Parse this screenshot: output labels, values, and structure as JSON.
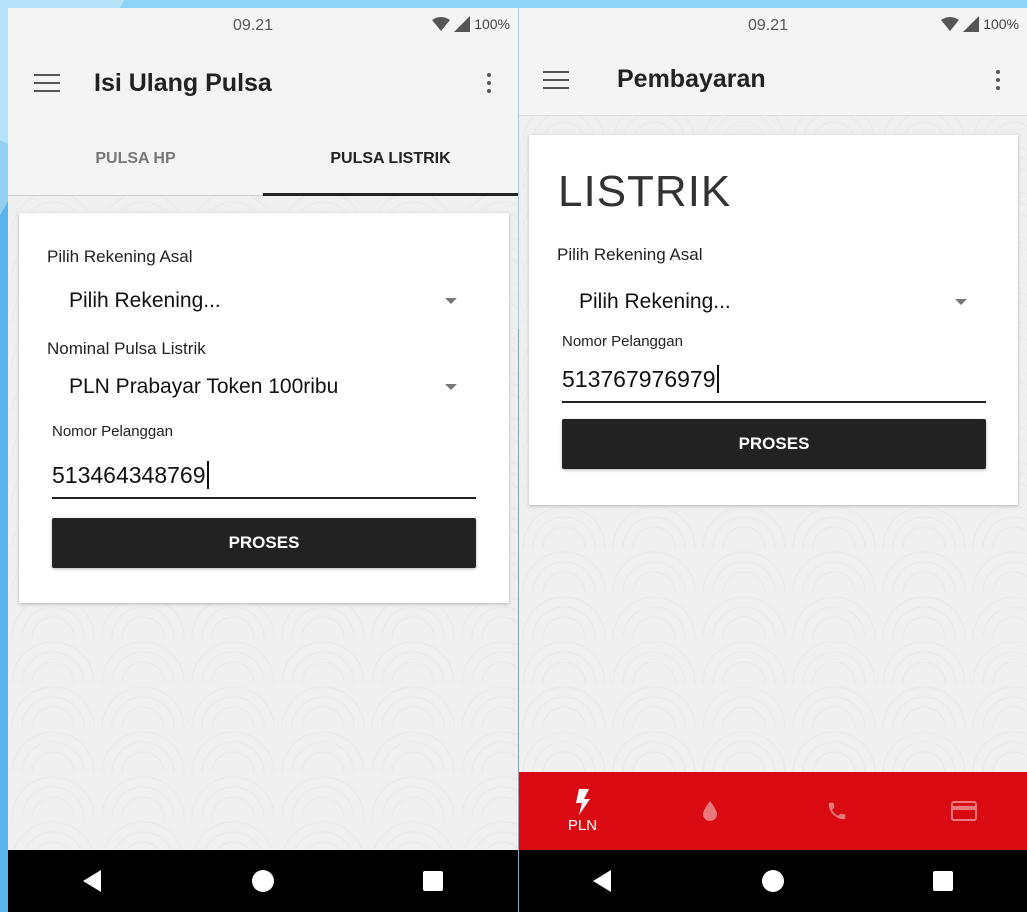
{
  "left_screen": {
    "status": {
      "time": "09.21",
      "battery": "100%"
    },
    "appbar": {
      "title": "Isi Ulang Pulsa"
    },
    "tabs": [
      {
        "label": "PULSA HP",
        "active": false
      },
      {
        "label": "PULSA LISTRIK",
        "active": true
      }
    ],
    "form": {
      "account_label": "Pilih Rekening Asal",
      "account_value": "Pilih Rekening...",
      "nominal_label": "Nominal Pulsa Listrik",
      "nominal_value": "PLN Prabayar Token 100ribu",
      "customer_label": "Nomor Pelanggan",
      "customer_value": "513464348769",
      "submit_label": "PROSES"
    }
  },
  "right_screen": {
    "status": {
      "time": "09.21",
      "battery": "100%"
    },
    "appbar": {
      "title": "Pembayaran"
    },
    "form": {
      "heading": "LISTRIK",
      "account_label": "Pilih Rekening Asal",
      "account_value": "Pilih Rekening...",
      "customer_label": "Nomor Pelanggan",
      "customer_value": "513767976979",
      "submit_label": "PROSES"
    },
    "bottom_nav": [
      {
        "icon": "lightning-icon",
        "label": "PLN",
        "active": true
      },
      {
        "icon": "water-drop-icon",
        "label": "",
        "active": false
      },
      {
        "icon": "phone-icon",
        "label": "",
        "active": false
      },
      {
        "icon": "credit-card-icon",
        "label": "",
        "active": false
      }
    ]
  },
  "colors": {
    "accent_red": "#d90a12",
    "button_dark": "#222222",
    "appbar_bg": "#f4f4f4"
  }
}
